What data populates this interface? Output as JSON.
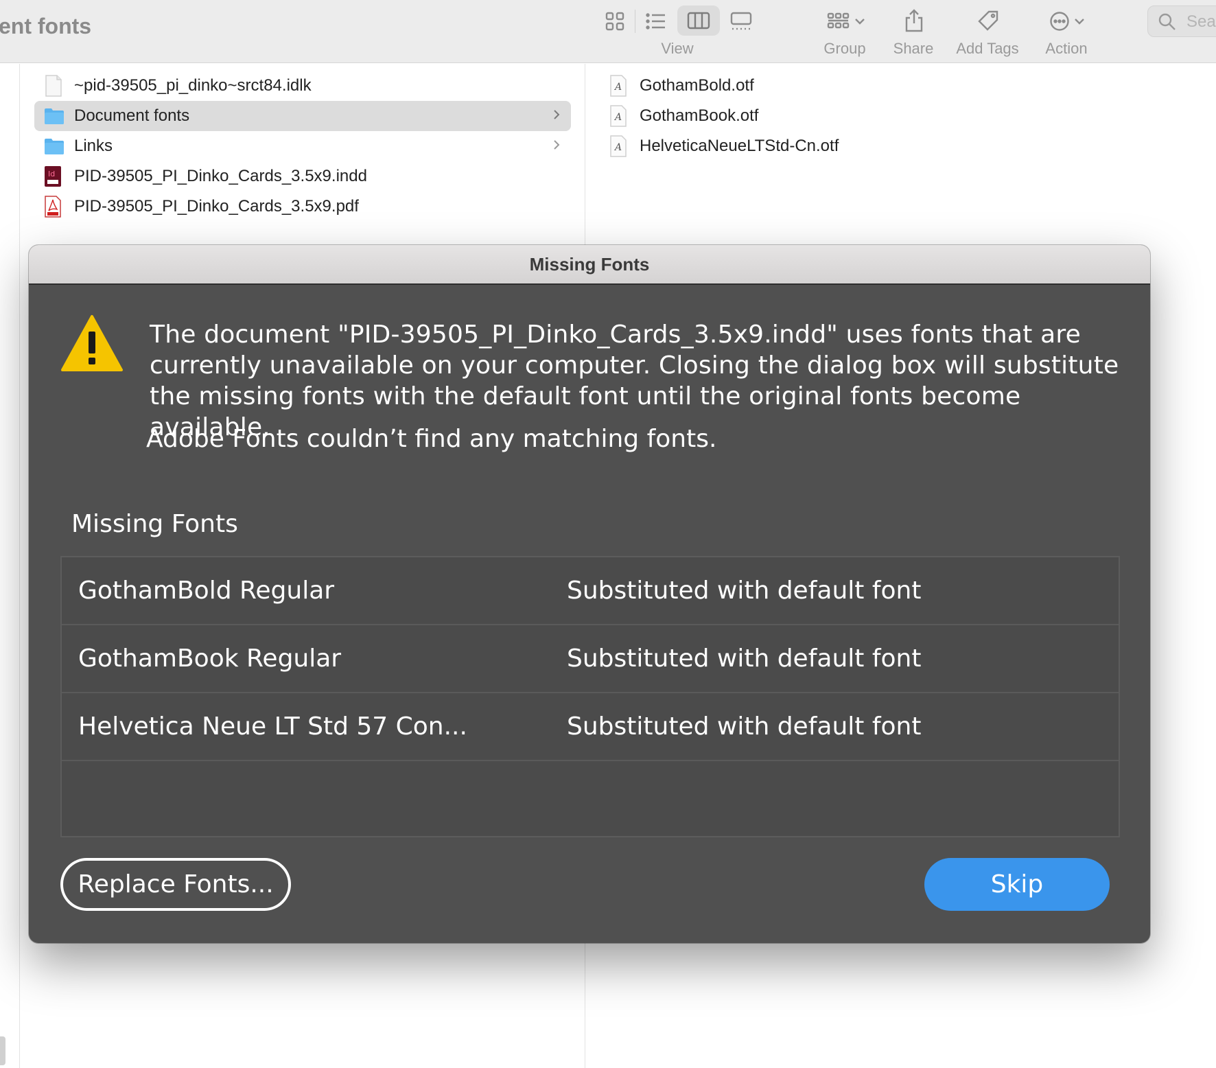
{
  "finder": {
    "window_title": "ent fonts",
    "toolbar": {
      "view_label": "View",
      "group_label": "Group",
      "share_label": "Share",
      "add_tags_label": "Add Tags",
      "action_label": "Action",
      "search_placeholder": "Sea",
      "active_view": "column-view"
    },
    "left_column": {
      "items": [
        {
          "name": "~pid-39505_pi_dinko~srct84.idlk",
          "icon": "generic-file-icon"
        },
        {
          "name": "Document fonts",
          "icon": "folder-icon",
          "selected": true
        },
        {
          "name": "Links",
          "icon": "folder-icon"
        },
        {
          "name": "PID-39505_PI_Dinko_Cards_3.5x9.indd",
          "icon": "indesign-file-icon"
        },
        {
          "name": "PID-39505_PI_Dinko_Cards_3.5x9.pdf",
          "icon": "pdf-file-icon"
        }
      ]
    },
    "right_column": {
      "items": [
        {
          "name": "GothamBold.otf",
          "icon": "font-file-icon"
        },
        {
          "name": "GothamBook.otf",
          "icon": "font-file-icon"
        },
        {
          "name": "HelveticaNeueLTStd-Cn.otf",
          "icon": "font-file-icon"
        }
      ]
    }
  },
  "dialog": {
    "title": "Missing Fonts",
    "message": "The document \"PID-39505_PI_Dinko_Cards_3.5x9.indd\" uses fonts that are currently unavailable on your computer. Closing the dialog box will substitute the missing fonts with the default font until the original fonts become available.",
    "adobe_fonts_note": "Adobe Fonts couldn’t find any matching fonts.",
    "section_label": "Missing Fonts",
    "fonts": [
      {
        "name": "GothamBold Regular",
        "status": "Substituted with default font"
      },
      {
        "name": "GothamBook Regular",
        "status": "Substituted with default font"
      },
      {
        "name": "Helvetica Neue LT Std 57 Con...",
        "status": "Substituted with default font"
      }
    ],
    "replace_button": "Replace Fonts...",
    "skip_button": "Skip"
  },
  "colors": {
    "dialog_bg": "#505050",
    "skip_accent": "#3a95ec",
    "warning_yellow": "#f5c400",
    "folder_blue": "#5ab3ee"
  }
}
